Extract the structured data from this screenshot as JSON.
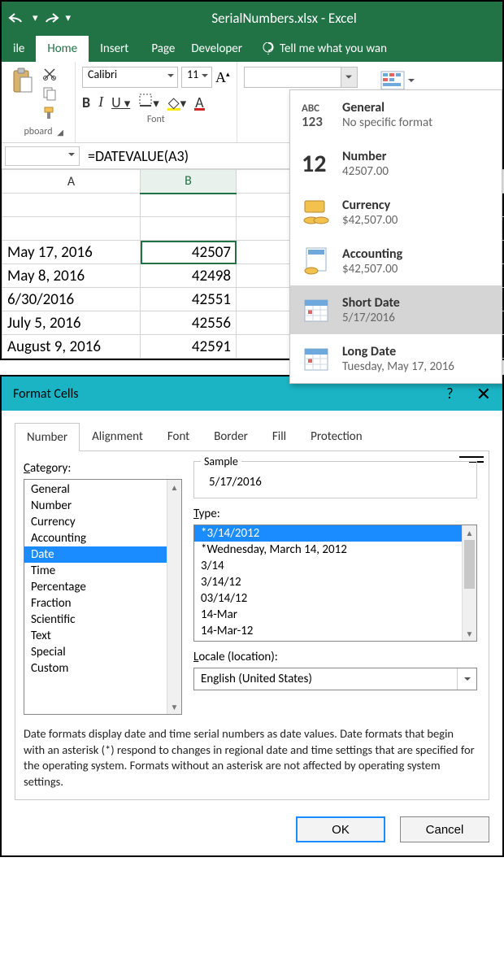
{
  "window": {
    "title": "SerialNumbers.xlsx - Excel"
  },
  "tabs": {
    "file": "ile",
    "home": "Home",
    "insert": "Insert",
    "page": "Page",
    "developer": "Developer",
    "tellme": "Tell me what you wan"
  },
  "ribbon": {
    "clipboard_label": "pboard",
    "font_label": "Font",
    "font_name": "Calibri",
    "font_size": "11",
    "bold": "B",
    "italic": "I",
    "underline": "U",
    "grow": "A",
    "fillcolor": "A"
  },
  "number_formats": [
    {
      "title": "General",
      "sub": "No specific format",
      "icon": "abc123"
    },
    {
      "title": "Number",
      "sub": "42507.00",
      "icon": "twelve"
    },
    {
      "title": "Currency",
      "sub": "$42,507.00",
      "icon": "coins"
    },
    {
      "title": "Accounting",
      "sub": " $42,507.00",
      "icon": "ledger"
    },
    {
      "title": "Short Date",
      "sub": "5/17/2016",
      "icon": "cal",
      "selected": true
    },
    {
      "title": "Long Date",
      "sub": "Tuesday, May 17, 2016",
      "icon": "cal"
    }
  ],
  "formula": "=DATEVALUE(A3)",
  "columns": [
    "A",
    "B"
  ],
  "rows": [
    {
      "a": "",
      "b": ""
    },
    {
      "a": "",
      "b": ""
    },
    {
      "a": "May 17, 2016",
      "b": "42507",
      "sel": true
    },
    {
      "a": "May 8, 2016",
      "b": "42498"
    },
    {
      "a": "6/30/2016",
      "b": "42551"
    },
    {
      "a": "July 5, 2016",
      "b": "42556"
    },
    {
      "a": "August 9, 2016",
      "b": "42591"
    }
  ],
  "dialog": {
    "title": "Format Cells",
    "tabs": [
      "Number",
      "Alignment",
      "Font",
      "Border",
      "Fill",
      "Protection"
    ],
    "active_tab": 0,
    "category_label": "Category:",
    "categories": [
      "General",
      "Number",
      "Currency",
      "Accounting",
      "Date",
      "Time",
      "Percentage",
      "Fraction",
      "Scientific",
      "Text",
      "Special",
      "Custom"
    ],
    "category_selected": "Date",
    "sample_label": "Sample",
    "sample_value": "5/17/2016",
    "type_label": "Type:",
    "types": [
      "*3/14/2012",
      "*Wednesday, March 14, 2012",
      "3/14",
      "3/14/12",
      "03/14/12",
      "14-Mar",
      "14-Mar-12"
    ],
    "type_selected": "*3/14/2012",
    "locale_label": "Locale (location):",
    "locale_value": "English (United States)",
    "description": "Date formats display date and time serial numbers as date values.  Date formats that begin with an asterisk (*) respond to changes in regional date and time settings that are specified for the operating system.  Formats without an asterisk are not affected by operating system settings.",
    "ok": "OK",
    "cancel": "Cancel"
  }
}
